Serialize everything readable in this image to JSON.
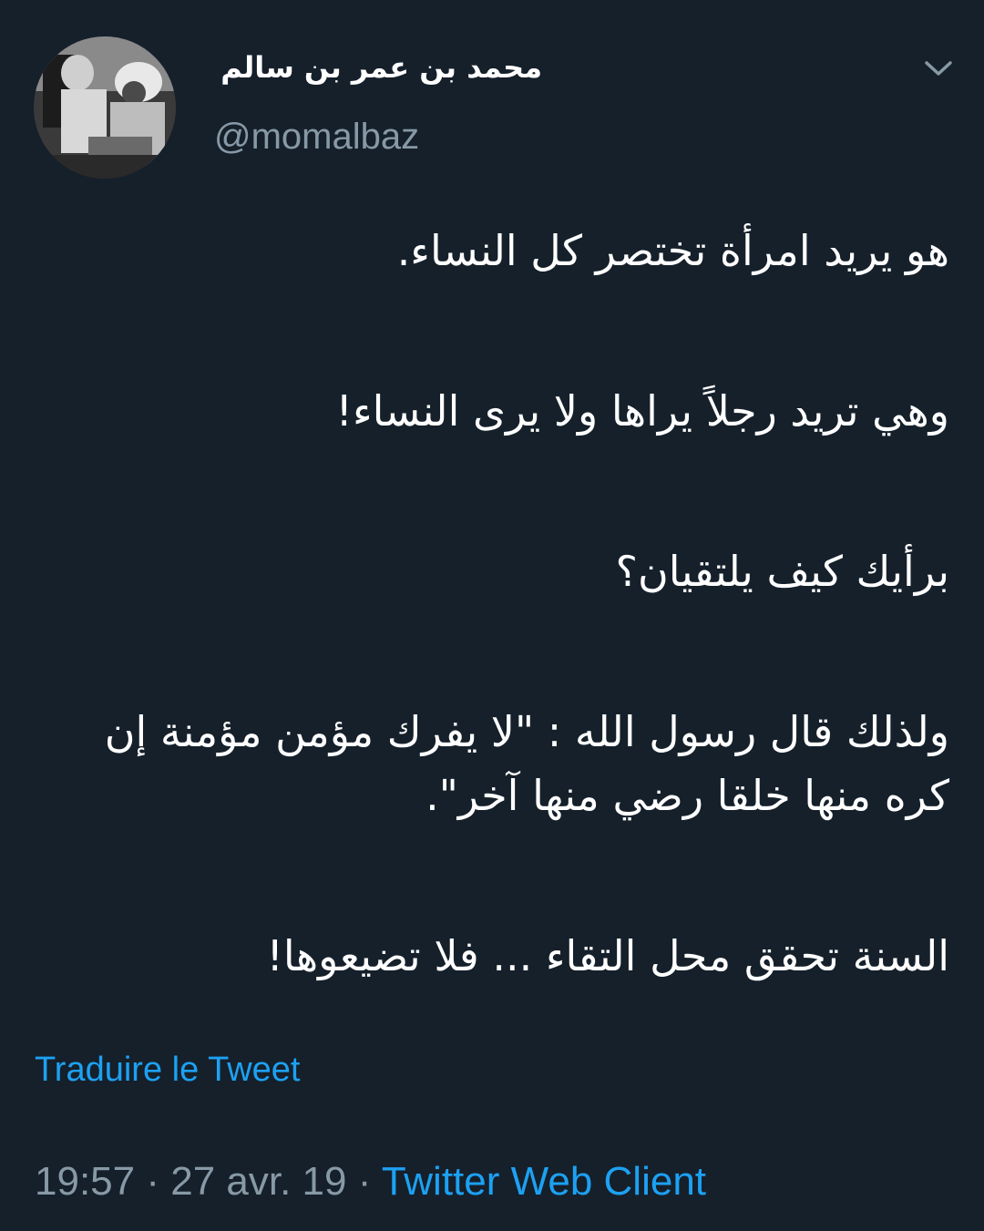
{
  "author": {
    "name": "محمد بن عمر بن سالم",
    "handle": "@momalbaz"
  },
  "tweet": {
    "paragraphs": [
      "هو يريد امرأة تختصر كل النساء.",
      "وهي تريد رجلاً يراها ولا يرى النساء!",
      "برأيك كيف يلتقيان؟",
      "ولذلك قال رسول الله : \"لا يفرك مؤمن مؤمنة إن كره منها خلقا رضي منها آخر\".",
      "السنة تحقق محل التقاء ... فلا تضيعوها!"
    ]
  },
  "translate_label": "Traduire le Tweet",
  "meta": {
    "time": "19:57",
    "separator": "·",
    "date": "27 avr. 19",
    "client": "Twitter Web Client"
  },
  "colors": {
    "background": "#15202b",
    "text": "#ffffff",
    "secondary": "#8899a6",
    "link": "#1da1f2"
  },
  "icons": {
    "caret": "chevron-down-icon",
    "avatar": "avatar"
  }
}
